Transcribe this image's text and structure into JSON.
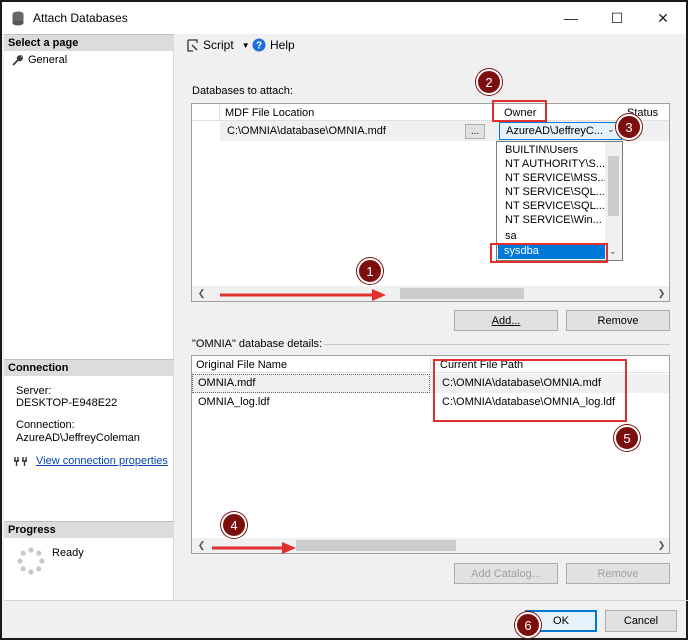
{
  "window": {
    "title": "Attach Databases",
    "minimize_glyph": "—",
    "maximize_glyph": "☐",
    "close_glyph": "✕"
  },
  "leftpane": {
    "select_page_header": "Select a page",
    "pages": [
      {
        "label": "General",
        "icon": "wrench-icon"
      }
    ],
    "connection_header": "Connection",
    "server_label": "Server:",
    "server_value": "DESKTOP-E948E22",
    "connection_label": "Connection:",
    "connection_value": "AzureAD\\JeffreyColeman",
    "view_props_link": "View connection properties",
    "progress_header": "Progress",
    "progress_status": "Ready"
  },
  "toolbar": {
    "script_label": "Script",
    "help_label": "Help"
  },
  "attach": {
    "section_label": "Databases to attach:",
    "columns": [
      "MDF File Location",
      "Owner",
      "Status"
    ],
    "row": {
      "mdf_path": "C:\\OMNIA\\database\\OMNIA.mdf",
      "browse_label": "...",
      "owner_value": "AzureAD\\JeffreyC..."
    },
    "owner_options": [
      "BUILTIN\\Users",
      "NT AUTHORITY\\S...",
      "NT SERVICE\\MSS...",
      "NT SERVICE\\SQL...",
      "NT SERVICE\\SQL...",
      "NT SERVICE\\Win...",
      "sa",
      "sysdba"
    ],
    "add_label": "Add...",
    "remove_label": "Remove"
  },
  "details": {
    "section_label": "\"OMNIA\" database details:",
    "columns": [
      "Original File Name",
      "Current File Path"
    ],
    "rows": [
      {
        "name": "OMNIA.mdf",
        "path": "C:\\OMNIA\\database\\OMNIA.mdf"
      },
      {
        "name": "OMNIA_log.ldf",
        "path": "C:\\OMNIA\\database\\OMNIA_log.ldf"
      }
    ],
    "add_catalog_label": "Add Catalog...",
    "remove_label": "Remove"
  },
  "footer": {
    "ok_label": "OK",
    "cancel_label": "Cancel"
  },
  "callouts": [
    "1",
    "2",
    "3",
    "4",
    "5",
    "6"
  ],
  "colors": {
    "callout": "#7d0e0e",
    "highlight_box": "#e03030",
    "selection": "#0078d7",
    "link": "#0645ad"
  }
}
